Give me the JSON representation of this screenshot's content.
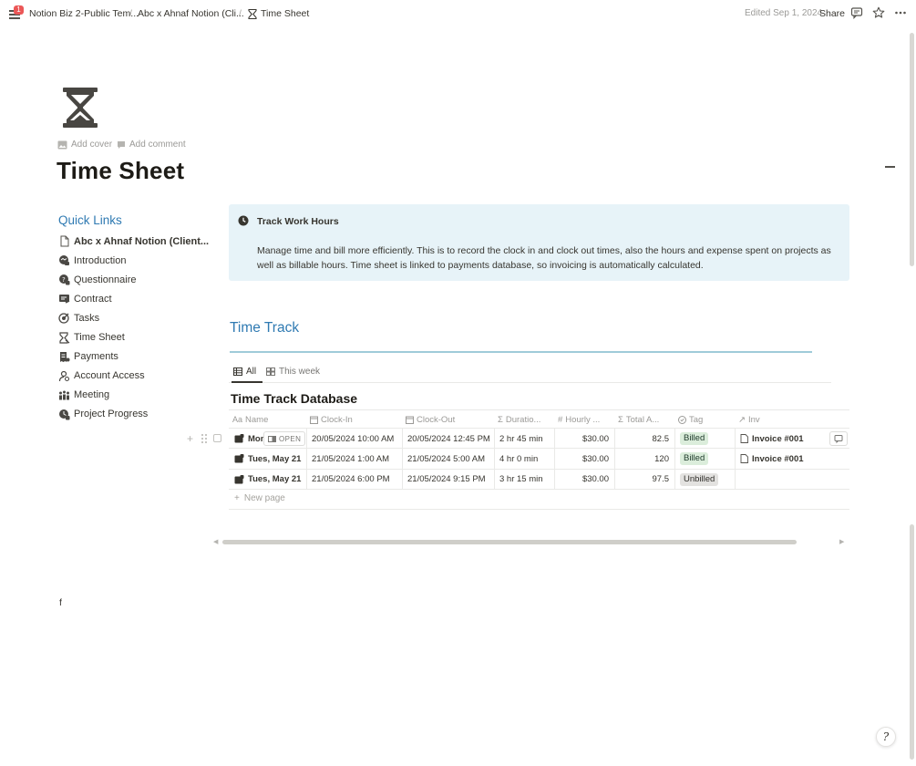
{
  "topbar": {
    "notification_count": "1",
    "breadcrumbs": [
      "Notion Biz 2-Public Tem...",
      "Abc x Ahnaf Notion (Cli...",
      "Time Sheet"
    ],
    "separator": "/",
    "edited": "Edited Sep 1, 2024",
    "share_label": "Share"
  },
  "page": {
    "icon": "hourglass-icon",
    "add_cover": "Add cover",
    "add_comment": "Add comment",
    "title": "Time Sheet"
  },
  "quick_links": {
    "title": "Quick Links",
    "items": [
      {
        "label": "Abc x Ahnaf Notion (Client...",
        "icon": "page-icon"
      },
      {
        "label": "Introduction",
        "icon": "handshake-icon"
      },
      {
        "label": "Questionnaire",
        "icon": "questionnaire-icon"
      },
      {
        "label": "Contract",
        "icon": "contract-icon"
      },
      {
        "label": "Tasks",
        "icon": "target-icon"
      },
      {
        "label": "Time Sheet",
        "icon": "hourglass-icon"
      },
      {
        "label": "Payments",
        "icon": "receipt-icon"
      },
      {
        "label": "Account Access",
        "icon": "user-key-icon"
      },
      {
        "label": "Meeting",
        "icon": "people-icon"
      },
      {
        "label": "Project Progress",
        "icon": "progress-icon"
      }
    ]
  },
  "callout": {
    "title": "Track Work Hours",
    "body": "Manage time and bill more efficiently. This is to record the clock in and clock out times, also the hours and expense spent on projects as well as billable hours. Time sheet is linked to payments database, so invoicing is automatically calculated.",
    "background": "#e7f3f8"
  },
  "time_track": {
    "heading": "Time Track",
    "views": [
      {
        "label": "All",
        "icon": "table-icon",
        "active": true
      },
      {
        "label": "This week",
        "icon": "gallery-icon",
        "active": false
      }
    ],
    "database_title": "Time Track Database",
    "columns": [
      {
        "label": "Name",
        "icon": "Aa"
      },
      {
        "label": "Clock-In",
        "icon": "calendar-icon"
      },
      {
        "label": "Clock-Out",
        "icon": "calendar-icon"
      },
      {
        "label": "Duratio...",
        "icon": "sigma-icon"
      },
      {
        "label": "Hourly ...",
        "icon": "hash-icon"
      },
      {
        "label": "Total A...",
        "icon": "sigma-icon"
      },
      {
        "label": "Tag",
        "icon": "status-icon"
      },
      {
        "label": "Inv",
        "icon": "relation-arrow-icon"
      }
    ],
    "rows": [
      {
        "name": "Mon",
        "clock_in": "20/05/2024 10:00 AM",
        "clock_out": "20/05/2024 12:45 PM",
        "duration": "2 hr 45 min",
        "hourly": "$30.00",
        "total": "82.5",
        "tag": "Billed",
        "invoice": "Invoice #001"
      },
      {
        "name": "Tues, May 21",
        "clock_in": "21/05/2024 1:00 AM",
        "clock_out": "21/05/2024 5:00 AM",
        "duration": "4 hr 0 min",
        "hourly": "$30.00",
        "total": "120",
        "tag": "Billed",
        "invoice": "Invoice #001"
      },
      {
        "name": "Tues, May 21",
        "clock_in": "21/05/2024 6:00 PM",
        "clock_out": "21/05/2024 9:15 PM",
        "duration": "3 hr 15 min",
        "hourly": "$30.00",
        "total": "97.5",
        "tag": "Unbilled",
        "invoice": ""
      }
    ],
    "open_label": "OPEN",
    "new_page": "New page",
    "tag_colors": {
      "Billed": "#dbeddb",
      "Unbilled": "#e3e2e0"
    }
  },
  "stray_text": "f",
  "help_label": "?",
  "accent_color": "#2f7ab2"
}
